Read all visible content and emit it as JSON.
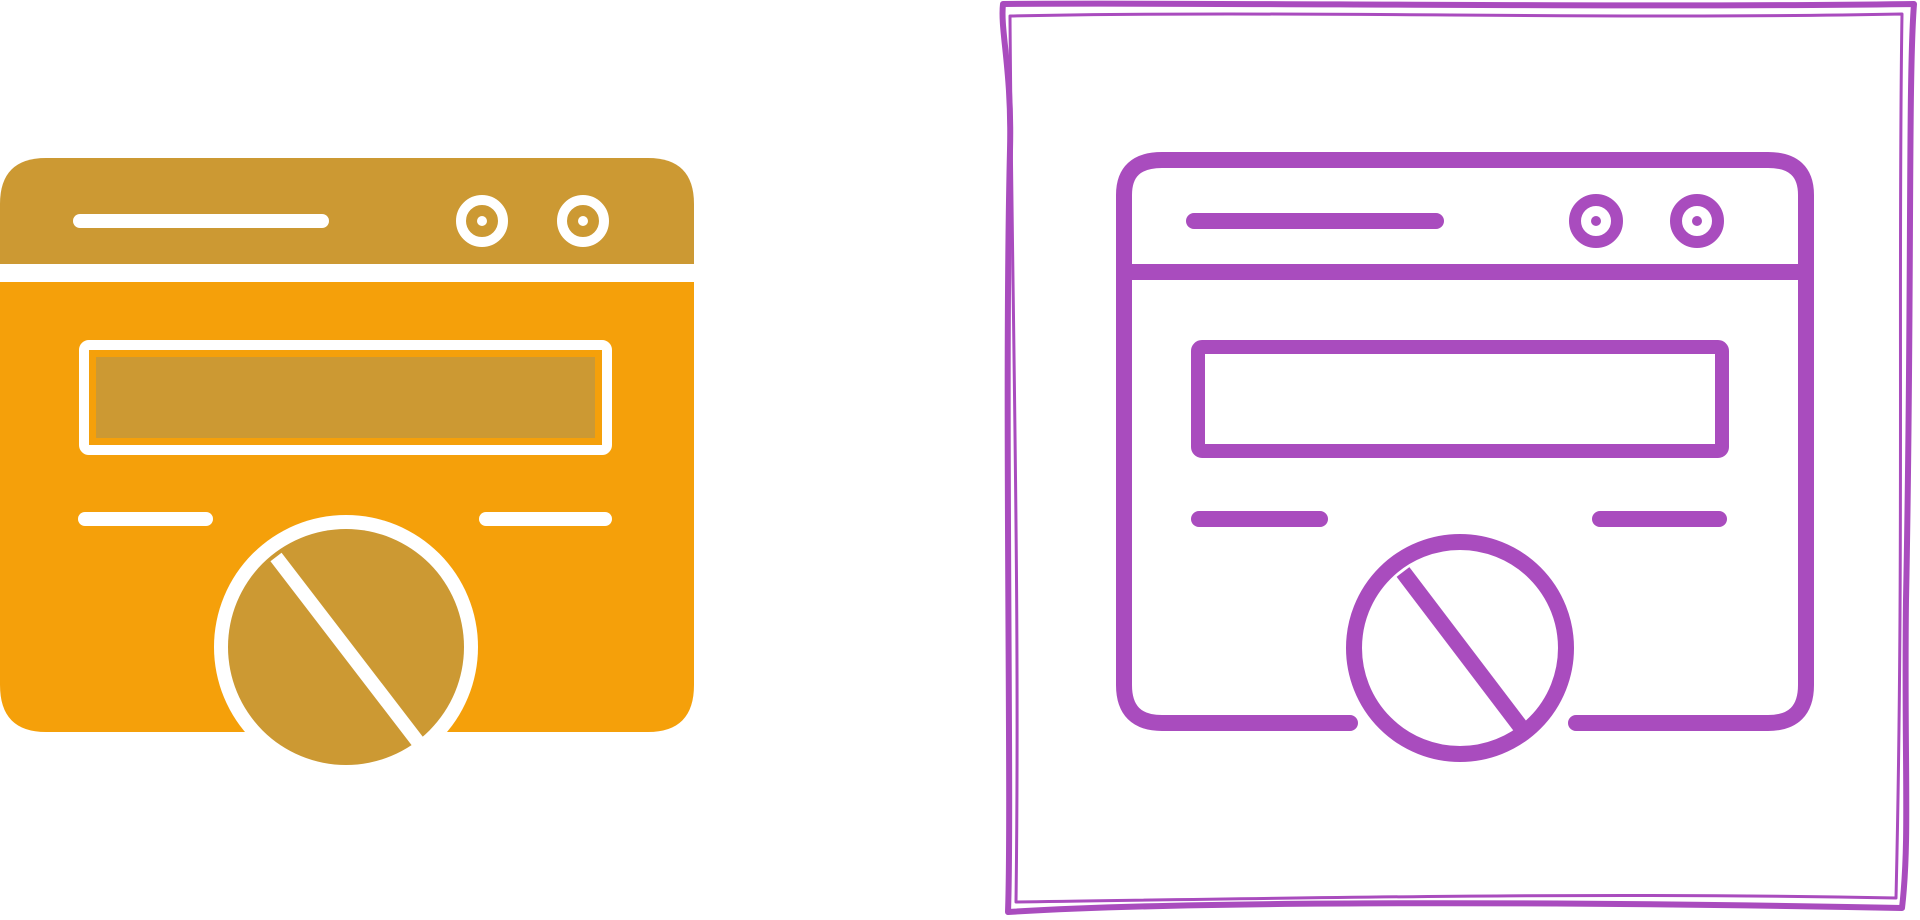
{
  "icons": [
    {
      "name": "blocked-browser-glyph-icon",
      "style": "glyph",
      "colors": {
        "header": "#CC9933",
        "body": "#F5A00A",
        "accent": "#CC9933",
        "detail": "#FFFFFF"
      }
    },
    {
      "name": "blocked-browser-line-icon",
      "style": "line",
      "colors": {
        "stroke": "#A94CBE",
        "background": "#FFFFFF"
      }
    }
  ]
}
